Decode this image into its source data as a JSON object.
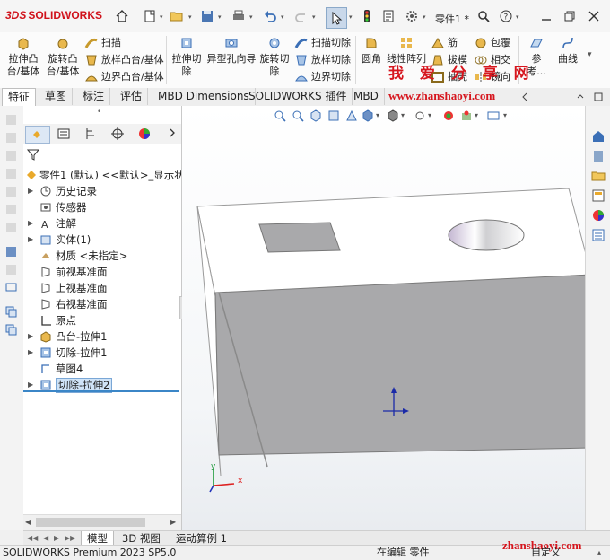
{
  "app": {
    "brand_prefix": "3DS",
    "brand_name": "SOLIDWORKS",
    "doc_name": "零件1 *",
    "titlebar_icons": [
      "home-icon",
      "new-doc-icon",
      "open-icon",
      "save-icon",
      "print-icon",
      "undo-icon",
      "redo-icon",
      "select-pointer-icon",
      "traffic-light-icon",
      "file-props-icon",
      "gear-icon",
      "search-icon",
      "help-icon",
      "minimize-icon",
      "restore-icon",
      "close-icon"
    ]
  },
  "ribbon": {
    "extrude_boss": "拉伸凸\n台/基体",
    "revolve_boss": "旋转凸\n台/基体",
    "sweep": "扫描",
    "loft": "放样凸台/基体",
    "boundary": "边界凸台/基体",
    "extrude_cut": "拉伸切\n除",
    "hole_wizard": "异型孔向导",
    "revolve_cut": "旋转切\n除",
    "sweep_cut": "扫描切除",
    "loft_cut": "放样切除",
    "boundary_cut": "边界切除",
    "fillet": "圆角",
    "linear_pattern": "线性阵列",
    "rib": "筋",
    "wrap": "包覆",
    "draft": "拔模",
    "intersect": "相交",
    "shell": "抽壳",
    "mirror": "镜向",
    "reference": "参考...",
    "curves": "曲线"
  },
  "watermark": {
    "cn": "我 爱 分 享 网",
    "url": "www.zhanshaoyi.com",
    "url_bottom": "zhanshaoyi.com"
  },
  "tabs": [
    "特征",
    "草图",
    "标注",
    "评估",
    "MBD Dimensions",
    "SOLIDWORKS 插件",
    "MBD"
  ],
  "feature_manager": {
    "root": "零件1 (默认) <<默认>_显示状",
    "items": [
      {
        "label": "历史记录",
        "icon": "history-icon",
        "arrow": true
      },
      {
        "label": "传感器",
        "icon": "sensor-icon",
        "arrow": false
      },
      {
        "label": "注解",
        "icon": "annotation-icon",
        "arrow": true
      },
      {
        "label": "实体(1)",
        "icon": "solid-bodies-icon",
        "arrow": true
      },
      {
        "label": "材质 <未指定>",
        "icon": "material-icon",
        "arrow": false
      },
      {
        "label": "前视基准面",
        "icon": "plane-icon",
        "arrow": false
      },
      {
        "label": "上视基准面",
        "icon": "plane-icon",
        "arrow": false
      },
      {
        "label": "右视基准面",
        "icon": "plane-icon",
        "arrow": false
      },
      {
        "label": "原点",
        "icon": "origin-icon",
        "arrow": false
      },
      {
        "label": "凸台-拉伸1",
        "icon": "extrude-icon",
        "arrow": true
      },
      {
        "label": "切除-拉伸1",
        "icon": "cut-extrude-icon",
        "arrow": true
      },
      {
        "label": "草图4",
        "icon": "sketch-icon",
        "arrow": false
      },
      {
        "label": "切除-拉伸2",
        "icon": "cut-extrude-icon",
        "arrow": true,
        "selected": true
      }
    ]
  },
  "bottom_tabs": [
    "模型",
    "3D 视图",
    "运动算例 1"
  ],
  "status": {
    "product": "SOLIDWORKS Premium 2023 SP5.0",
    "mode": "在编辑 零件",
    "custom": "自定义"
  },
  "colors": {
    "accent_red": "#d0121b",
    "selection_blue": "#3b86c7",
    "model_gray": "#a9a9ab"
  }
}
